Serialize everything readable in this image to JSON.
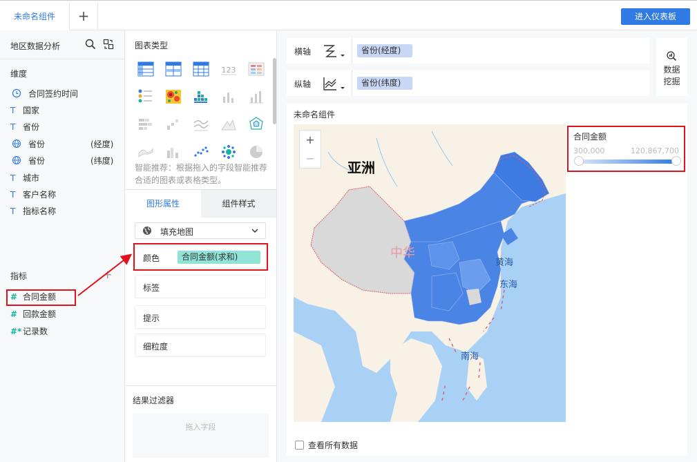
{
  "top": {
    "tab_label": "未命名组件",
    "add_tab": "+",
    "enter_dashboard": "进入仪表板"
  },
  "left": {
    "dataset_title": "地区数据分析",
    "dimension_label": "维度",
    "dimensions": [
      {
        "icon": "clock-icon",
        "name": "合同签约时间",
        "sub": ""
      },
      {
        "icon": "text-type-icon",
        "name": "国家",
        "sub": ""
      },
      {
        "icon": "text-type-icon",
        "name": "省份",
        "sub": ""
      },
      {
        "icon": "globe-icon",
        "name": "省份",
        "sub": "(经度)"
      },
      {
        "icon": "globe-icon",
        "name": "省份",
        "sub": "(纬度)"
      },
      {
        "icon": "text-type-icon",
        "name": "城市",
        "sub": ""
      },
      {
        "icon": "text-type-icon",
        "name": "客户名称",
        "sub": ""
      },
      {
        "icon": "text-type-icon",
        "name": "指标名称",
        "sub": ""
      }
    ],
    "metric_label": "指标",
    "metric_add": "+",
    "metrics": [
      {
        "icon": "hash-icon",
        "name": "合同金额"
      },
      {
        "icon": "hash-icon",
        "name": "回款金额"
      },
      {
        "icon": "hash-star-icon",
        "name": "记录数"
      }
    ],
    "type_text": "T",
    "hash_text": "#",
    "hash_star_text": "#*"
  },
  "mid": {
    "chart_type_title": "图表类型",
    "smart_tip": "智能推荐：根据拖入的字段智能推荐合适的图表或表格类型。",
    "tab_shape": "图形属性",
    "tab_style": "组件样式",
    "map_type": "填充地图",
    "props": {
      "color": "颜色",
      "color_field": "合同金额(求和)",
      "label": "标签",
      "tooltip": "提示",
      "granularity": "细粒度"
    },
    "filter_title": "结果过滤器",
    "filter_placeholder": "拖入字段",
    "number_icon_text": "123"
  },
  "right": {
    "x_axis_label": "横轴",
    "x_axis_field": "省份(经度)",
    "y_axis_label": "纵轴",
    "y_axis_field": "省份(纬度)",
    "mining_line1": "数据",
    "mining_line2": "挖掘",
    "widget_title": "未命名组件",
    "map_labels": {
      "asia": "亚洲",
      "china": "中华",
      "yellow_sea": "黄海",
      "east_sea": "东海",
      "south_sea": "南海"
    },
    "zoom_in": "+",
    "zoom_out": "−",
    "legend_title": "合同金额",
    "legend_min": "300,000",
    "legend_max": "120,867,700",
    "see_all": "查看所有数据"
  },
  "colors": {
    "accent": "#2f7ae5",
    "highlight": "#e0121b",
    "teal_pill": "#8fe3d7",
    "blue_pill": "#c7d7f5",
    "map_fill": "#4a85e6",
    "sea": "#a9d0f5"
  }
}
